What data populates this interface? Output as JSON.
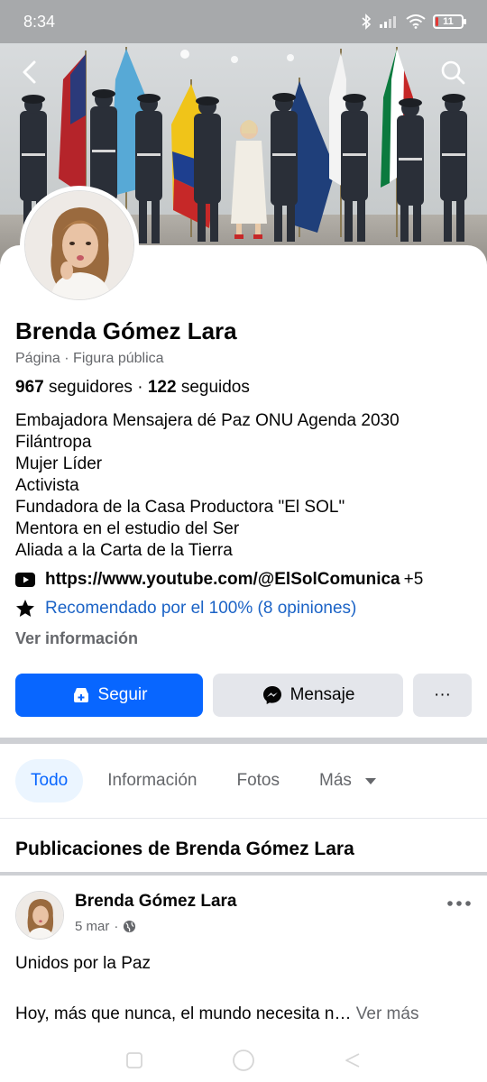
{
  "status_bar": {
    "time": "8:34",
    "battery_level": "11",
    "battery_fraction": 0.11
  },
  "header": {
    "back_icon": "back-arrow-icon",
    "search_icon": "search-icon"
  },
  "profile": {
    "name": "Brenda Gómez Lara",
    "category": "Página · Figura pública",
    "followers_count": "967",
    "followers_label": "seguidores",
    "separator": "·",
    "following_count": "122",
    "following_label": "seguidos",
    "bio": [
      "Embajadora Mensajera dé Paz ONU Agenda 2030",
      "Filántropa",
      "Mujer Líder",
      "Activista",
      "Fundadora de la Casa Productora \"El SOL\"",
      "Mentora en el estudio del Ser",
      "Aliada a la Carta de la Tierra"
    ],
    "link": "https://www.youtube.com/@ElSolComunica",
    "link_extra": "+5",
    "recommendation": "Recomendado por el 100% (8 opiniones)",
    "see_info": "Ver información"
  },
  "actions": {
    "follow": "Seguir",
    "message": "Mensaje",
    "more": "···"
  },
  "tabs": [
    {
      "label": "Todo",
      "active": true
    },
    {
      "label": "Información",
      "active": false
    },
    {
      "label": "Fotos",
      "active": false
    },
    {
      "label": "Más",
      "active": false
    }
  ],
  "posts_section": {
    "title": "Publicaciones de Brenda Gómez Lara"
  },
  "post": {
    "author": "Brenda Gómez Lara",
    "date": "5 mar",
    "dot": "·",
    "line1": "Unidos por la Paz",
    "line2": "Hoy, más que nunca, el mundo necesita n…",
    "see_more": "Ver más"
  },
  "colors": {
    "accent": "#0866ff",
    "link": "#1b63c6",
    "secondary_text": "#65676b",
    "button_grey": "#e4e6eb"
  }
}
